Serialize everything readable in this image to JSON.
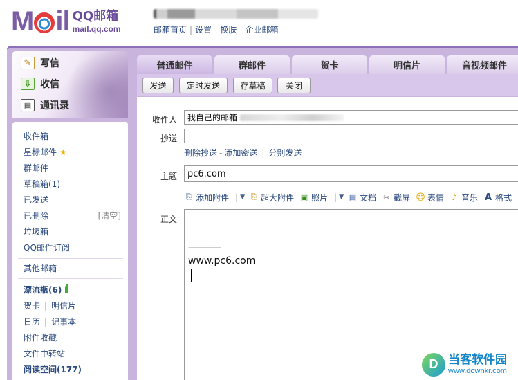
{
  "header": {
    "logo_word": "MAIL",
    "logo_name": "QQ邮箱",
    "logo_domain": "mail.qq.com",
    "links": [
      "邮箱首页",
      "设置",
      "换肤",
      "企业邮箱"
    ]
  },
  "sidebar": {
    "primary": [
      {
        "label": "写信",
        "icon": "pencil-icon"
      },
      {
        "label": "收信",
        "icon": "inbox-download-icon"
      },
      {
        "label": "通讯录",
        "icon": "contact-card-icon"
      }
    ],
    "folders": {
      "inbox": "收件箱",
      "starred": "星标邮件",
      "group": "群邮件",
      "drafts": "草稿箱(1)",
      "sent": "已发送",
      "deleted": "已删除",
      "deleted_action": "[清空]",
      "spam": "垃圾箱",
      "subscriptions": "QQ邮件订阅"
    },
    "other_mailboxes": "其他邮箱",
    "drift_bottle": "漂流瓶(6)",
    "greeting_card": "贺卡",
    "postcard": "明信片",
    "calendar": "日历",
    "notepad": "记事本",
    "attachments": "附件收藏",
    "file_transfer": "文件中转站",
    "reading_space": "阅读空间(177)"
  },
  "compose": {
    "tabs": [
      "普通邮件",
      "群邮件",
      "贺卡",
      "明信片",
      "音视频邮件"
    ],
    "toolbar": {
      "send": "发送",
      "scheduled_send": "定时发送",
      "save_draft": "存草稿",
      "close": "关闭"
    },
    "labels": {
      "to": "收件人",
      "cc": "抄送",
      "subject": "主题",
      "body": "正文"
    },
    "to_value": "我自己的邮箱",
    "cc_value": "",
    "cc_links": {
      "remove_cc": "删除抄送",
      "add_bcc": "添加密送",
      "separate_send": "分别发送"
    },
    "subject_value": "pc6.com",
    "editor_tools": {
      "attach": "添加附件",
      "large_attach": "超大附件",
      "photo": "照片",
      "doc": "文档",
      "screenshot": "截屏",
      "emoticon": "表情",
      "music": "音乐",
      "format": "格式"
    },
    "body_separator": "------------------",
    "body_text": "www.pc6.com"
  },
  "watermark": {
    "name": "当客软件园",
    "url": "www.downkr.com"
  },
  "colors": {
    "brand_purple": "#7b5da4",
    "frame_purple": "#c8b4dd",
    "link_blue": "#2b4a7f"
  }
}
